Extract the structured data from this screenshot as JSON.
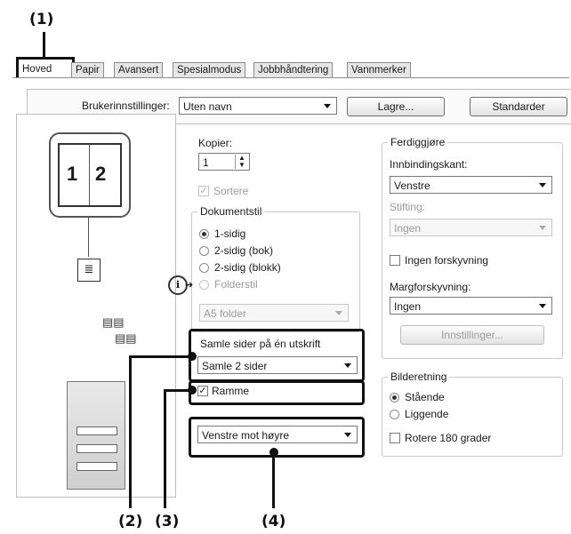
{
  "callouts": {
    "c1": "(1)",
    "c2": "(2)",
    "c3": "(3)",
    "c4": "(4)"
  },
  "tabs": [
    "Hoved",
    "Papir",
    "Avansert",
    "Spesialmodus",
    "Jobbhåndtering",
    "Vannmerker"
  ],
  "top": {
    "user_settings_label": "Brukerinnstillinger:",
    "user_settings_value": "Uten navn",
    "save_label": "Lagre...",
    "defaults_label": "Standarder"
  },
  "preview": {
    "page_left": "1",
    "page_right": "2"
  },
  "copies": {
    "label": "Kopier:",
    "value": "1",
    "collate_label": "Sortere"
  },
  "document_style": {
    "title": "Dokumentstil",
    "options": [
      "1-sidig",
      "2-sidig (bok)",
      "2-sidig (blokk)",
      "Folderstil"
    ],
    "selected": "1-sidig",
    "folder_value": "A5 folder"
  },
  "nup": {
    "title": "Samle sider på én utskrift",
    "value": "Samle 2 sider",
    "border_label": "Ramme",
    "border_checked": true,
    "order_value": "Venstre mot høyre"
  },
  "finishing": {
    "title": "Ferdiggjøre",
    "binding_label": "Innbindingskant:",
    "binding_value": "Venstre",
    "staple_label": "Stifting:",
    "staple_value": "Ingen",
    "no_offset_label": "Ingen forskyvning",
    "margin_label": "Margforskyvning:",
    "margin_value": "Ingen",
    "settings_label": "Innstillinger..."
  },
  "orientation": {
    "title": "Bilderetning",
    "portrait": "Stående",
    "landscape": "Liggende",
    "rotate_label": "Rotere 180 grader",
    "selected": "Stående"
  }
}
